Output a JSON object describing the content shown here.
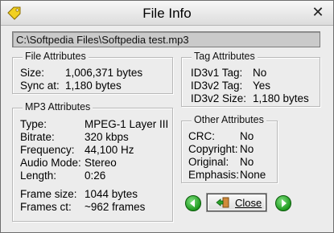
{
  "window": {
    "title": "File Info"
  },
  "path": "C:\\Softpedia Files\\Softpedia test.mp3",
  "file_attributes": {
    "title": "File Attributes",
    "rows": [
      {
        "label": "Size:",
        "value": "1,006,371 bytes"
      },
      {
        "label": "Sync at:",
        "value": "1,180 bytes"
      }
    ]
  },
  "tag_attributes": {
    "title": "Tag Attributes",
    "rows": [
      {
        "label": "ID3v1 Tag:",
        "value": "No"
      },
      {
        "label": "ID3v2 Tag:",
        "value": "Yes"
      },
      {
        "label": "ID3v2 Size:",
        "value": "1,180 bytes"
      }
    ]
  },
  "mp3_attributes": {
    "title": "MP3 Attributes",
    "rows": [
      {
        "label": "Type:",
        "value": "MPEG-1 Layer III"
      },
      {
        "label": "Bitrate:",
        "value": "320 kbps"
      },
      {
        "label": "Frequency:",
        "value": "44,100 Hz"
      },
      {
        "label": "Audio Mode:",
        "value": "Stereo"
      },
      {
        "label": "Length:",
        "value": "0:26"
      },
      {
        "label": "Frame size:",
        "value": "1044 bytes"
      },
      {
        "label": "Frames ct:",
        "value": "~962 frames"
      }
    ]
  },
  "other_attributes": {
    "title": "Other Attributes",
    "rows": [
      {
        "label": "CRC:",
        "value": "No"
      },
      {
        "label": "Copyright:",
        "value": "No"
      },
      {
        "label": "Original:",
        "value": "No"
      },
      {
        "label": "Emphasis:",
        "value": "None"
      }
    ]
  },
  "buttons": {
    "close_label": "Close"
  },
  "colors": {
    "accent_green": "#1f9a1f",
    "title_bg": "#e6e6e6",
    "window_bg": "#ececec"
  }
}
